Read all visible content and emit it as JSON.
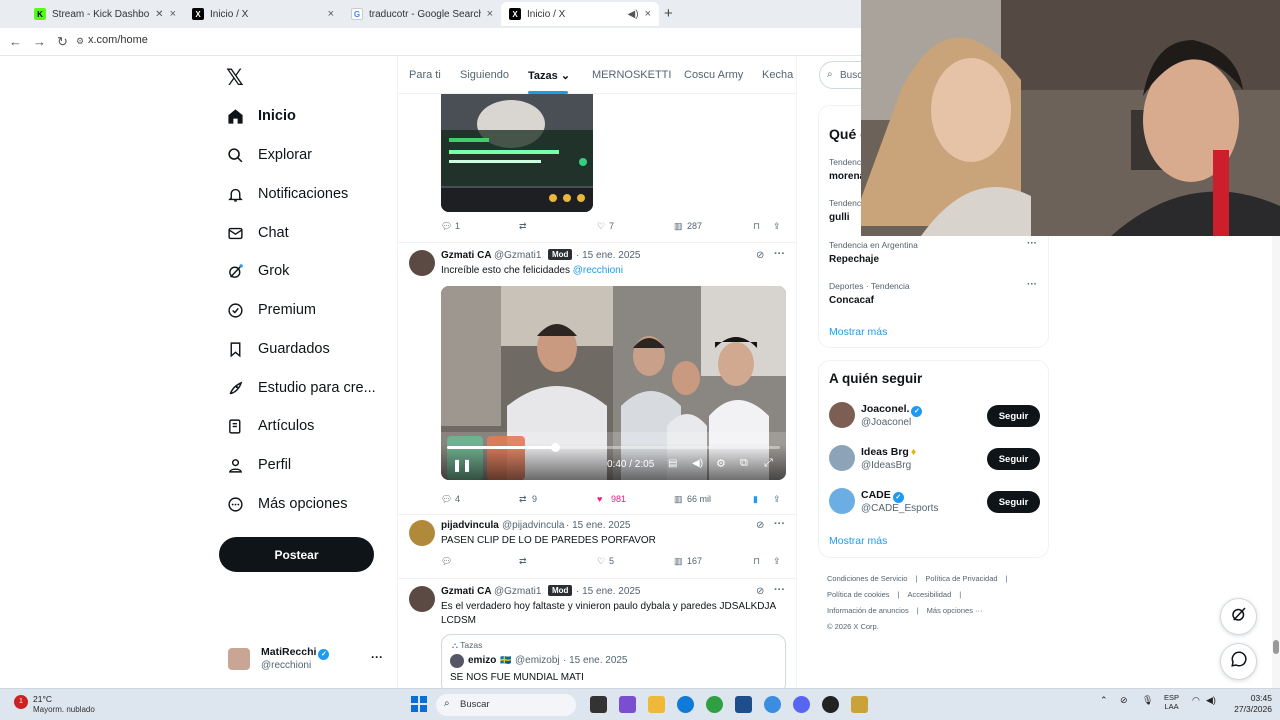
{
  "browser": {
    "tabs": [
      {
        "label": "Stream - Kick Dashboard",
        "active": false,
        "icon": "kick-icon"
      },
      {
        "label": "Inicio / X",
        "active": false,
        "icon": "x-icon"
      },
      {
        "label": "traducotr - Google Search",
        "active": false,
        "icon": "google-icon"
      },
      {
        "label": "Inicio / X",
        "active": true,
        "icon": "x-icon"
      }
    ],
    "url": "x.com/home"
  },
  "sidebar": {
    "items": [
      {
        "label": "Inicio",
        "icon": "home-icon"
      },
      {
        "label": "Explorar",
        "icon": "search-icon"
      },
      {
        "label": "Notificaciones",
        "icon": "bell-icon"
      },
      {
        "label": "Chat",
        "icon": "mail-icon"
      },
      {
        "label": "Grok",
        "icon": "grok-icon"
      },
      {
        "label": "Premium",
        "icon": "premium-icon"
      },
      {
        "label": "Guardados",
        "icon": "bookmark-icon"
      },
      {
        "label": "Estudio para cre...",
        "icon": "rocket-icon"
      },
      {
        "label": "Artículos",
        "icon": "article-icon"
      },
      {
        "label": "Perfil",
        "icon": "person-icon"
      },
      {
        "label": "Más opciones",
        "icon": "more-icon"
      }
    ],
    "post_label": "Postear",
    "account": {
      "name": "MatiRecchi",
      "handle": "@recchioni"
    }
  },
  "timeline": {
    "tabs": [
      "Para ti",
      "Siguiendo",
      "Tazas",
      "MERNOSKETTI",
      "Coscu Army",
      "Kecha y"
    ],
    "selected_tab": "Tazas",
    "tweet0_actions": {
      "replies": "1",
      "likes": "7",
      "views": "287"
    },
    "tweet1": {
      "name": "Gzmati CA",
      "handle": "@Gzmati1",
      "badge": "Mod",
      "date": "· 15 ene. 2025",
      "text": "Increíble esto che felicidades ",
      "mention": "@recchioni",
      "video_time": "0:40 / 2:05",
      "actions": {
        "replies": "4",
        "retweets": "9",
        "likes": "981",
        "views": "66 mil"
      }
    },
    "tweet2": {
      "name": "pijadvincula",
      "handle": "@pijadvincula",
      "date": "· 15 ene. 2025",
      "text": "PASEN CLIP DE LO DE PAREDES PORFAVOR",
      "actions": {
        "likes": "5",
        "views": "167"
      }
    },
    "tweet3": {
      "name": "Gzmati CA",
      "handle": "@Gzmati1",
      "badge": "Mod",
      "date": "· 15 ene. 2025",
      "text": "Es el verdadero hoy faltaste y vinieron paulo dybala y paredes JDSALKDJA LCDSM",
      "quote": {
        "community": "Tazas",
        "name": "emizo",
        "handle": "@emizobj",
        "date": "· 15 ene. 2025",
        "text": "SE NOS FUE MUNDIAL MATI"
      }
    }
  },
  "right": {
    "search_placeholder": "Busc",
    "trends_title": "Qué e",
    "trends": [
      {
        "context": "Tendenc",
        "name": "morena"
      },
      {
        "context": "Tendenc",
        "name": "gulli"
      },
      {
        "context": "Tendencia en Argentina",
        "name": "Repechaje"
      },
      {
        "context": "Deportes · Tendencia",
        "name": "Concacaf"
      }
    ],
    "show_more": "Mostrar más",
    "who_title": "A quién seguir",
    "who": [
      {
        "name": "Joaconel.",
        "handle": "@Joaconel",
        "button": "Seguir"
      },
      {
        "name": "Ideas Brg",
        "handle": "@IdeasBrg",
        "button": "Seguir"
      },
      {
        "name": "CADE",
        "handle": "@CADE_Esports",
        "button": "Seguir"
      }
    ],
    "who_more": "Mostrar más",
    "footer": [
      "Condiciones de Servicio",
      "|",
      "Política de Privacidad",
      "|",
      "Política de cookies",
      "|",
      "Accesibilidad",
      "|",
      "Información de anuncios",
      "|",
      "Más opciones ···",
      "© 2026 X Corp."
    ]
  },
  "taskbar": {
    "temp": "21°C",
    "weather": "Mayorm. nublado",
    "search": "Buscar",
    "lang1": "ESP",
    "lang2": "LAA",
    "time": "03:45",
    "date": "27/3/2026"
  },
  "colors": {
    "accent": "#1d9bf0",
    "like": "#f91880",
    "dark": "#0f1419",
    "muted": "#536471"
  }
}
